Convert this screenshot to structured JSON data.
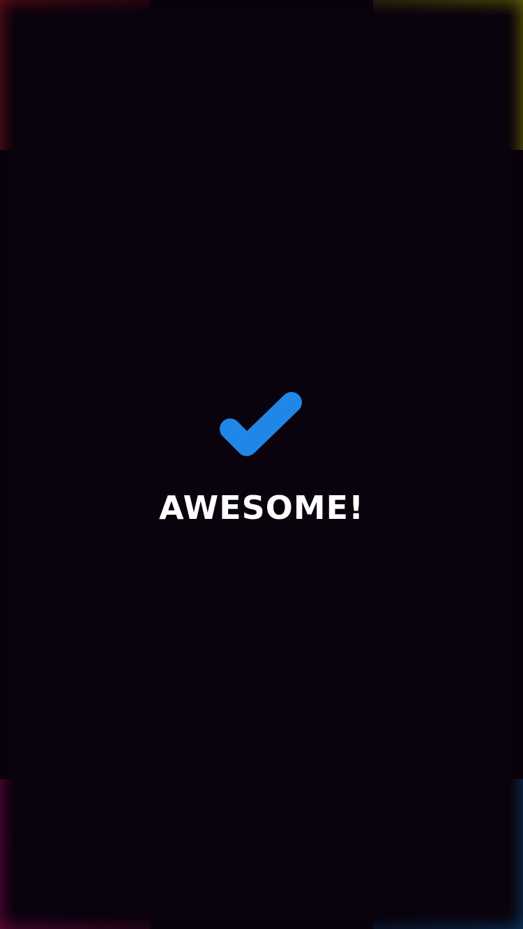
{
  "screen": {
    "title": "AWESOME!",
    "icon": "check-icon",
    "colors": {
      "background": "#0a020d",
      "accent": "#2087e6",
      "corner_top_left": "#6a1216",
      "corner_top_right": "#6b6a00",
      "corner_bottom_left": "#64073e",
      "corner_bottom_right": "#0a3a62"
    }
  }
}
